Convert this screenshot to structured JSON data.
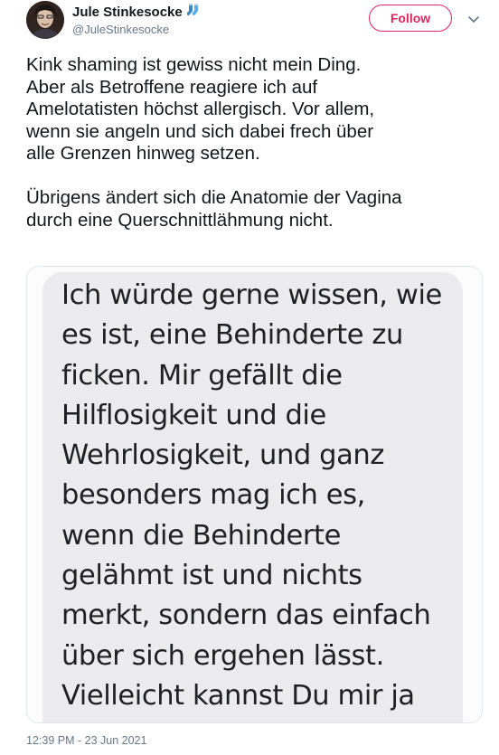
{
  "author": {
    "display_name": "Jule Stinkesocke",
    "handle": "@JuleStinkesocke",
    "name_emoji_icon": "socks-icon",
    "avatar_icon": "avatar"
  },
  "actions": {
    "follow_label": "Follow",
    "more_icon": "chevron-down-icon"
  },
  "tweet": {
    "text": "Kink shaming ist gewiss nicht mein Ding.\nAber als Betroffene reagiere ich auf\nAmelotatisten höchst allergisch. Vor allem,\nwenn sie angeln und sich dabei frech über\nalle Grenzen hinweg setzen.\n\nÜbrigens ändert sich die Anatomie der Vagina\ndurch eine Querschnittlähmung nicht.",
    "timestamp": "12:39 PM - 23 Jun 2021"
  },
  "media": {
    "message_text": "Ich würde gerne wissen, wie\nes ist, eine Behinderte zu\nficken. Mir gefällt die\nHilflosigkeit und die\nWehrlosigkeit, und ganz\nbesonders mag ich es,\nwenn die Behinderte\ngelähmt ist und nichts\nmerkt, sondern das einfach\nüber sich ergehen lässt.\nVielleicht kannst Du mir ja\nmal die Frage beantworten"
  },
  "colors": {
    "accent": "#e0245e",
    "text": "#14171a",
    "secondary": "#657786",
    "bubble": "#ececef"
  }
}
